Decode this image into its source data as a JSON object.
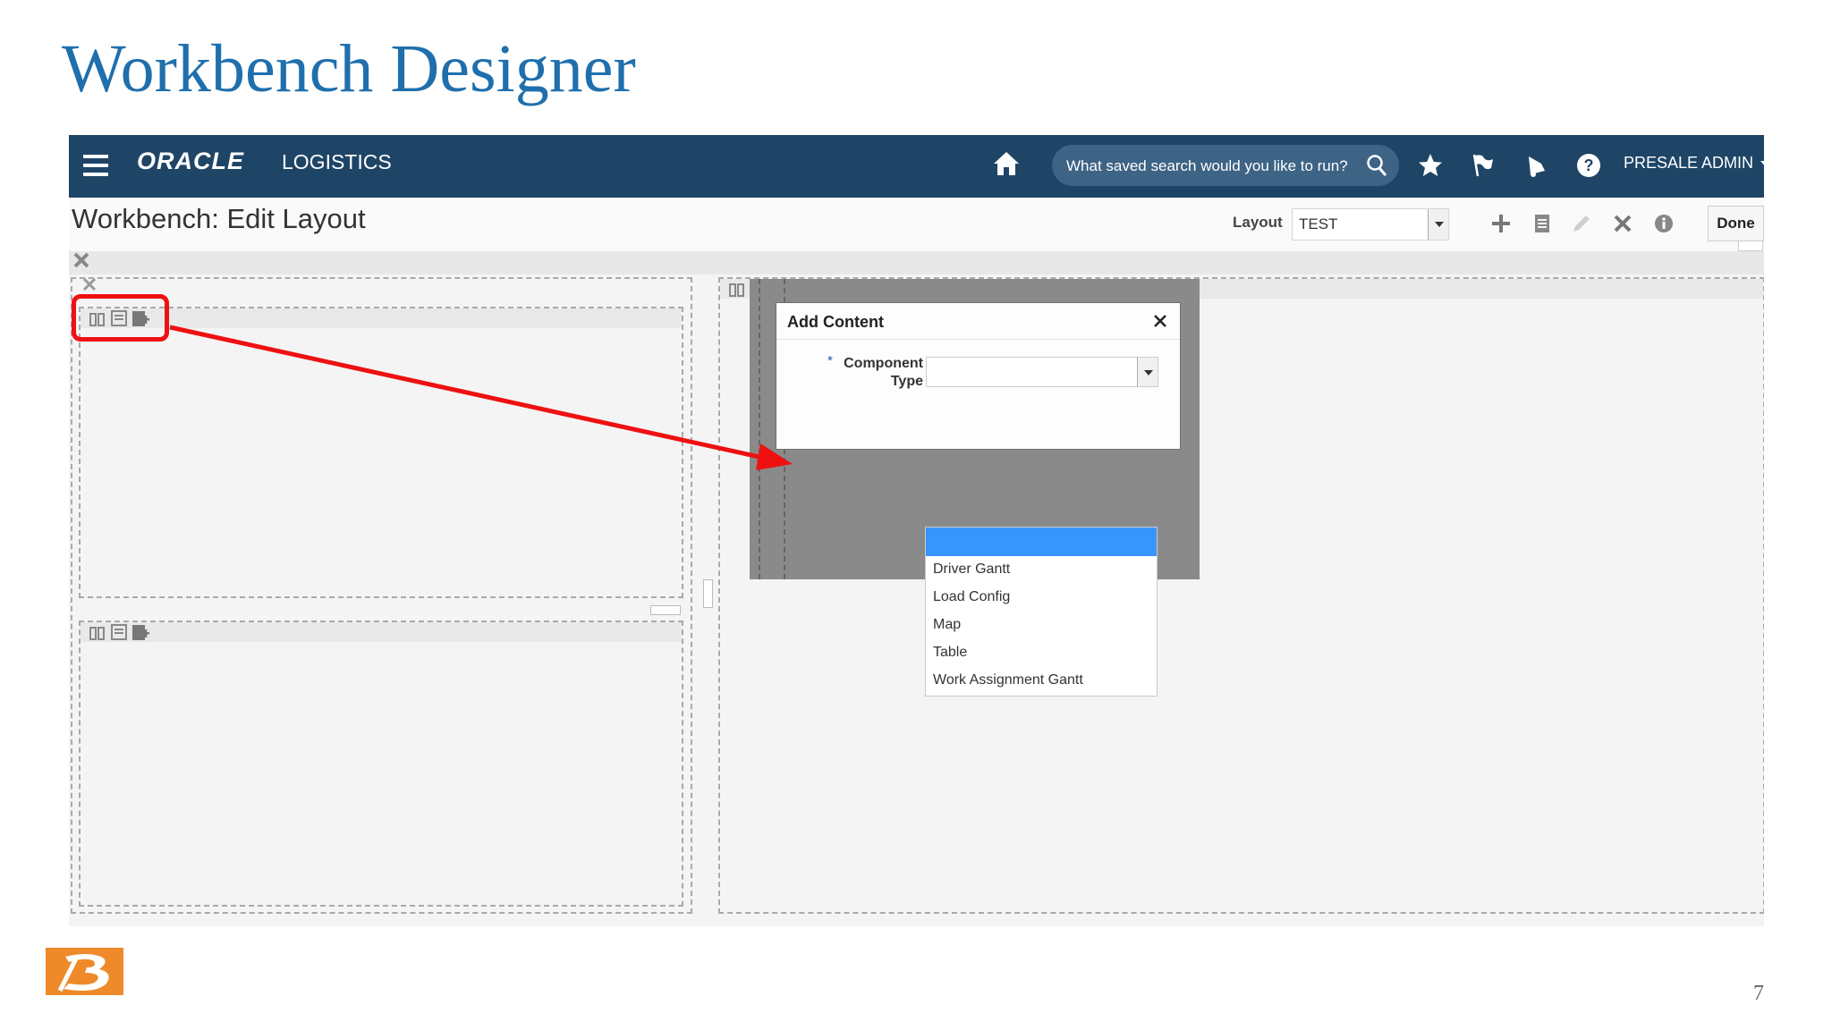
{
  "slide": {
    "title": "Workbench Designer",
    "page_number": "7"
  },
  "app": {
    "brand": "ORACLE",
    "product": "LOGISTICS",
    "search_placeholder": "What saved search would you like to run?",
    "user": "PRESALE ADMIN",
    "colors": {
      "topbar": "#1e4566",
      "accent_red": "#ee1111",
      "title_blue": "#1f6fad",
      "highlight": "#3795fd"
    }
  },
  "page": {
    "title": "Workbench: Edit Layout",
    "layout_label": "Layout",
    "layout_value": "TEST",
    "done_label": "Done"
  },
  "dialog": {
    "title": "Add Content",
    "required_marker": "*",
    "field_label": "Component Type",
    "options": [
      "",
      "Driver Gantt",
      "Load Config",
      "Map",
      "Table",
      "Work Assignment Gantt"
    ]
  },
  "icons": [
    "menu-icon",
    "home-icon",
    "search-icon",
    "star-icon",
    "flag-icon",
    "bell-icon",
    "help-icon",
    "add-icon",
    "list-icon",
    "edit-icon",
    "delete-icon",
    "info-icon",
    "close-icon",
    "add-content-icon"
  ]
}
